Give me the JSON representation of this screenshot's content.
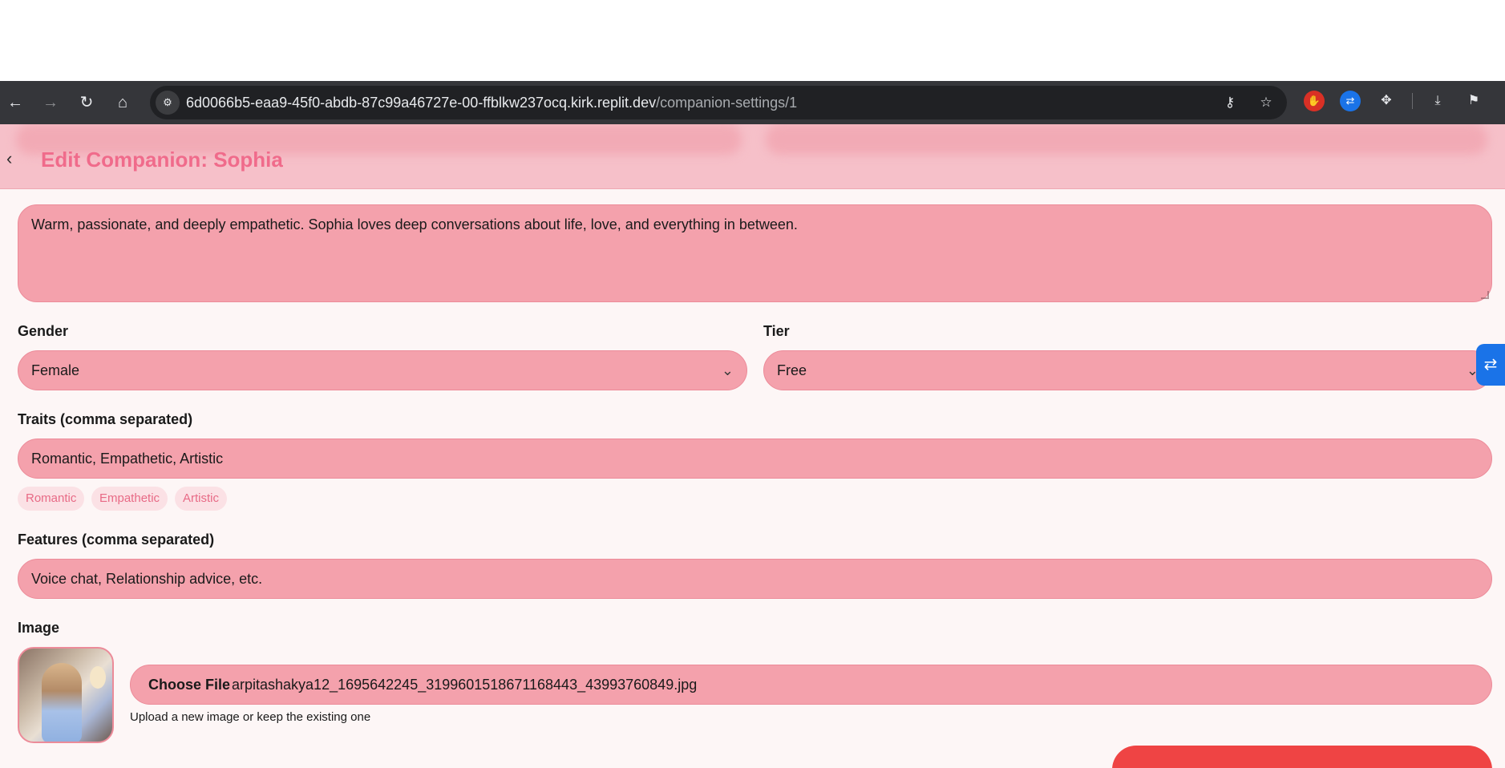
{
  "browser": {
    "url_host": "6d0066b5-eaa9-45f0-abdb-87c99a46727e-00-ffblkw237ocq.kirk.replit.dev",
    "url_path": "/companion-settings/1",
    "icons": [
      "back-arrow-icon",
      "forward-arrow-icon",
      "reload-icon",
      "home-icon",
      "site-info-icon",
      "password-key-icon",
      "bookmark-star-icon",
      "adblock-extension-icon",
      "sync-extension-icon",
      "extensions-puzzle-icon",
      "download-icon",
      "profile-extension-icon"
    ]
  },
  "header": {
    "back_icon": "chevron-left-icon",
    "title": "Edit Companion: Sophia"
  },
  "form": {
    "description": {
      "value": "Warm, passionate, and deeply empathetic. Sophia loves deep conversations about life, love, and everything in between."
    },
    "gender": {
      "label": "Gender",
      "value": "Female"
    },
    "tier": {
      "label": "Tier",
      "value": "Free"
    },
    "traits": {
      "label": "Traits (comma separated)",
      "value": "Romantic, Empathetic, Artistic",
      "chips": [
        "Romantic",
        "Empathetic",
        "Artistic"
      ]
    },
    "features": {
      "label": "Features (comma separated)",
      "placeholder": "Voice chat, Relationship advice, etc."
    },
    "image": {
      "label": "Image",
      "choose_file_label": "Choose File",
      "file_name": "arpitashakya12_1695642245_3199601518671168443_43993760849.jpg",
      "helper": "Upload a new image or keep the existing one"
    }
  },
  "colors": {
    "accent": "#f06b8b",
    "field_bg": "#f4a1ac",
    "header_bg": "#f6c0c9",
    "submit": "#ef4444",
    "browser_bar": "#35363a"
  }
}
